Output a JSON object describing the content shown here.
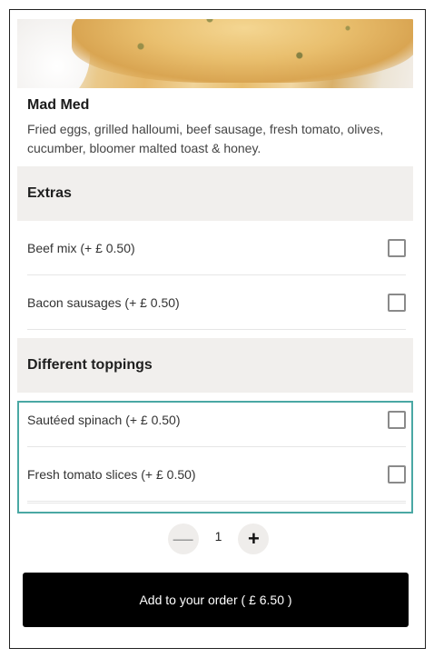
{
  "item": {
    "name": "Mad Med",
    "description": "Fried eggs, grilled halloumi, beef sausage, fresh tomato, olives, cucumber, bloomer malted toast & honey."
  },
  "sections": [
    {
      "title": "Extras",
      "options": [
        {
          "label": "Beef mix (+ £ 0.50)",
          "checked": false
        },
        {
          "label": "Bacon sausages (+ £ 0.50)",
          "checked": false
        }
      ]
    },
    {
      "title": "Different toppings",
      "options": [
        {
          "label": "Sautéed spinach (+ £ 0.50)",
          "checked": false
        },
        {
          "label": "Fresh tomato slices (+ £ 0.50)",
          "checked": false
        }
      ]
    }
  ],
  "quantity": {
    "value": "1",
    "minus_symbol": "—",
    "plus_symbol": "+"
  },
  "add_button": {
    "label": "Add to your order ( £ 6.50 )"
  },
  "colors": {
    "highlight": "#4aa8a4",
    "section_bg": "#f1efed",
    "button_bg": "#000000"
  }
}
